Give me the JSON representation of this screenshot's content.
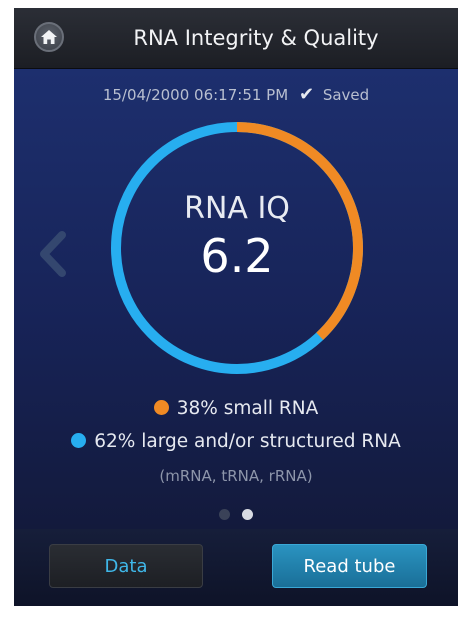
{
  "header": {
    "title": "RNA Integrity & Quality",
    "home_icon": "home-icon"
  },
  "status": {
    "timestamp": "15/04/2000 06:17:51 PM",
    "check_icon": "checkmark-icon",
    "saved_label": "Saved"
  },
  "result": {
    "label": "RNA IQ",
    "value": "6.2"
  },
  "composition": {
    "small": {
      "text": "38% small RNA",
      "percent": 38,
      "color": "#f08a24"
    },
    "large": {
      "text": "62% large and/or structured RNA",
      "percent": 62,
      "color": "#27aef0"
    },
    "note": "(mRNA, tRNA, rRNA)"
  },
  "navigation": {
    "prev_icon": "chevron-left-icon",
    "page_count": 2,
    "current_page": 2
  },
  "buttons": {
    "data_label": "Data",
    "read_tube_label": "Read tube"
  }
}
